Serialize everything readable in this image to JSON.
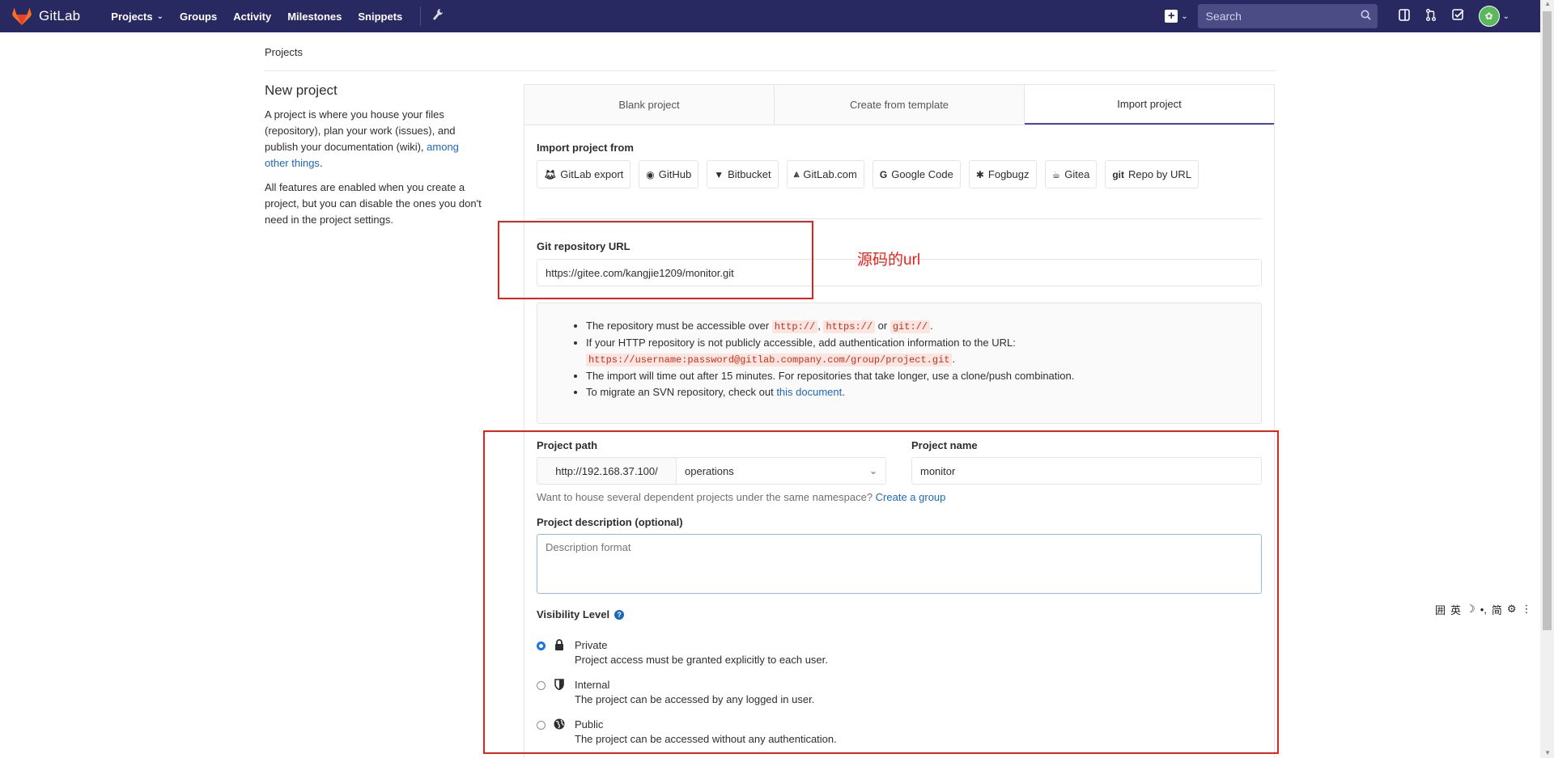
{
  "navbar": {
    "brand": "GitLab",
    "links": [
      {
        "label": "Projects",
        "caret": "⌄"
      },
      {
        "label": "Groups"
      },
      {
        "label": "Activity"
      },
      {
        "label": "Milestones"
      },
      {
        "label": "Snippets"
      }
    ],
    "search_placeholder": "Search",
    "colors": {
      "bar": "#292961",
      "search": "#4b4b85"
    }
  },
  "breadcrumb": "Projects",
  "sidebar": {
    "title": "New project",
    "p1_before": "A project is where you house your files (repository), plan your work (issues), and publish your documentation (wiki), ",
    "p1_link": "among other things",
    "p1_after": ".",
    "p2": "All features are enabled when you create a project, but you can disable the ones you don't need in the project settings."
  },
  "tabs": [
    {
      "label": "Blank project",
      "active": false
    },
    {
      "label": "Create from template",
      "active": false
    },
    {
      "label": "Import project",
      "active": true
    }
  ],
  "import": {
    "label": "Import project from",
    "sources": [
      {
        "label": "GitLab export",
        "icon": "gitlab-icon"
      },
      {
        "label": "GitHub",
        "icon": "github-icon"
      },
      {
        "label": "Bitbucket",
        "icon": "bitbucket-icon"
      },
      {
        "label": "GitLab.com",
        "icon": "gitlab-icon"
      },
      {
        "label": "Google Code",
        "icon": "google-icon"
      },
      {
        "label": "Fogbugz",
        "icon": "bug-icon"
      },
      {
        "label": "Gitea",
        "icon": "gitea-icon"
      },
      {
        "label": "Repo by URL",
        "icon": "git-icon"
      }
    ]
  },
  "git_url": {
    "label": "Git repository URL",
    "value": "https://gitee.com/kangjie1209/monitor.git",
    "annotation": "源码的url"
  },
  "info": {
    "line1_text": "The repository must be accessible over ",
    "line1_codes": [
      "http://",
      "https://",
      "git://"
    ],
    "line1_or": " or ",
    "line2_text": "If your HTTP repository is not publicly accessible, add authentication information to the URL:",
    "line2_code": "https://username:password@gitlab.company.com/group/project.git",
    "line3": "The import will time out after 15 minutes. For repositories that take longer, use a clone/push combination.",
    "line4_text": "To migrate an SVN repository, check out ",
    "line4_link": "this document"
  },
  "project": {
    "path_label": "Project path",
    "path_prefix": "http://192.168.37.100/",
    "namespace": "operations",
    "name_label": "Project name",
    "name_value": "monitor",
    "help_text": "Want to house several dependent projects under the same namespace? ",
    "help_link": "Create a group",
    "desc_label": "Project description (optional)",
    "desc_placeholder": "Description format"
  },
  "visibility": {
    "label": "Visibility Level",
    "options": [
      {
        "title": "Private",
        "desc": "Project access must be granted explicitly to each user.",
        "checked": true,
        "icon": "lock-icon"
      },
      {
        "title": "Internal",
        "desc": "The project can be accessed by any logged in user.",
        "checked": false,
        "icon": "shield-icon"
      },
      {
        "title": "Public",
        "desc": "The project can be accessed without any authentication.",
        "checked": false,
        "icon": "globe-icon"
      }
    ]
  },
  "ime": [
    "囲",
    "英",
    "☽",
    "•,",
    "简",
    "⚙",
    "⋮"
  ]
}
